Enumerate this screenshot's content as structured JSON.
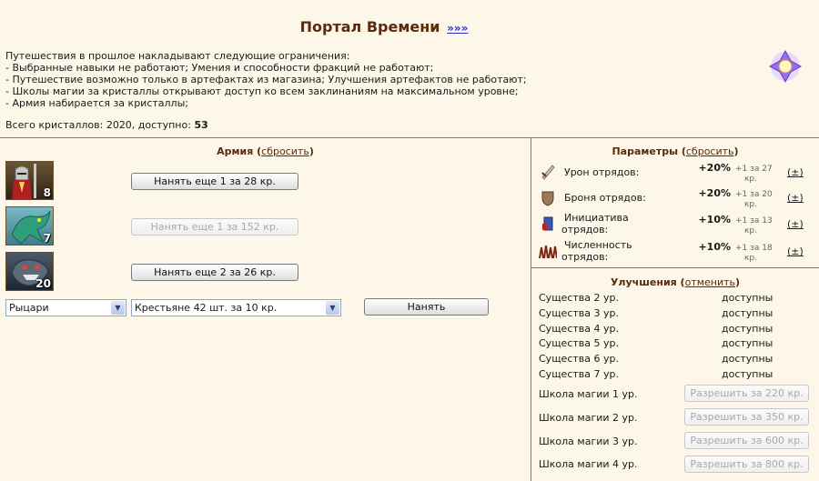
{
  "header": {
    "title": "Портал Времени",
    "title_link": "»»»"
  },
  "intro": {
    "lines": [
      "Путешествия в прошлое накладывают следующие ограничения:",
      "- Выбранные навыки не работают; Умения и способности фракций не работают;",
      "- Путешествие возможно только в артефактах из магазина; Улучшения артефактов не работают;",
      "- Школы магии за кристаллы открывают доступ ко всем заклинаниям на максимальном уровне;",
      "- Армия набирается за кристаллы;"
    ],
    "crystals_text": "Всего кристаллов: 2020, доступно:",
    "crystals_available": "53"
  },
  "army": {
    "title": "Армия",
    "reset_open": "(",
    "reset_label": "сбросить",
    "reset_close": ")",
    "units": [
      {
        "icon": "knight-unit-icon",
        "count": "8",
        "hire_label": "Нанять еще 1 за 28 кр.",
        "enabled": true
      },
      {
        "icon": "dragon-unit-icon",
        "count": "7",
        "hire_label": "Нанять еще 1 за 152 кр.",
        "enabled": false
      },
      {
        "icon": "beast-unit-icon",
        "count": "20",
        "hire_label": "Нанять еще 2 за 26 кр.",
        "enabled": true
      }
    ],
    "faction_select": "Рыцари",
    "creature_select": "Крестьяне 42 шт. за 10 кр.",
    "hire_button": "Нанять"
  },
  "params": {
    "title": "Параметры",
    "reset_label": "сбросить",
    "items": [
      {
        "icon": "sword-icon",
        "label1": "Урон отрядов:",
        "label2": "",
        "value": "+20%",
        "sub1": "+1 за 27",
        "sub2": "кр.",
        "pm": "(±)"
      },
      {
        "icon": "armor-icon",
        "label1": "Броня отрядов:",
        "label2": "",
        "value": "+20%",
        "sub1": "+1 за 20",
        "sub2": "кр.",
        "pm": "(±)"
      },
      {
        "icon": "initiative-icon",
        "label1": "Инициатива",
        "label2": "отрядов:",
        "value": "+10%",
        "sub1": "+1 за 13",
        "sub2": "кр.",
        "pm": "(±)"
      },
      {
        "icon": "troops-icon",
        "label1": "Численность",
        "label2": "отрядов:",
        "value": "+10%",
        "sub1": "+1 за 18",
        "sub2": "кр.",
        "pm": "(±)"
      }
    ]
  },
  "upgrades": {
    "title": "Улучшения",
    "cancel_label": "отменить",
    "creatures": [
      {
        "name": "Существа 2 ур.",
        "status": "доступны"
      },
      {
        "name": "Существа 3 ур.",
        "status": "доступны"
      },
      {
        "name": "Существа 4 ур.",
        "status": "доступны"
      },
      {
        "name": "Существа 5 ур.",
        "status": "доступны"
      },
      {
        "name": "Существа 6 ур.",
        "status": "доступны"
      },
      {
        "name": "Существа 7 ур.",
        "status": "доступны"
      }
    ],
    "magic": [
      {
        "name": "Школа магии 1 ур.",
        "button": "Разрешить за 220 кр."
      },
      {
        "name": "Школа магии 2 ур.",
        "button": "Разрешить за 350 кр."
      },
      {
        "name": "Школа магии 3 ур.",
        "button": "Разрешить за 600 кр."
      },
      {
        "name": "Школа магии 4 ур.",
        "button": "Разрешить за 800 кр."
      }
    ]
  },
  "colors": {
    "background": "#fdf7e9",
    "title": "#5a2a0c",
    "link": "#2b2bd6",
    "divider": "#8a7a62"
  }
}
